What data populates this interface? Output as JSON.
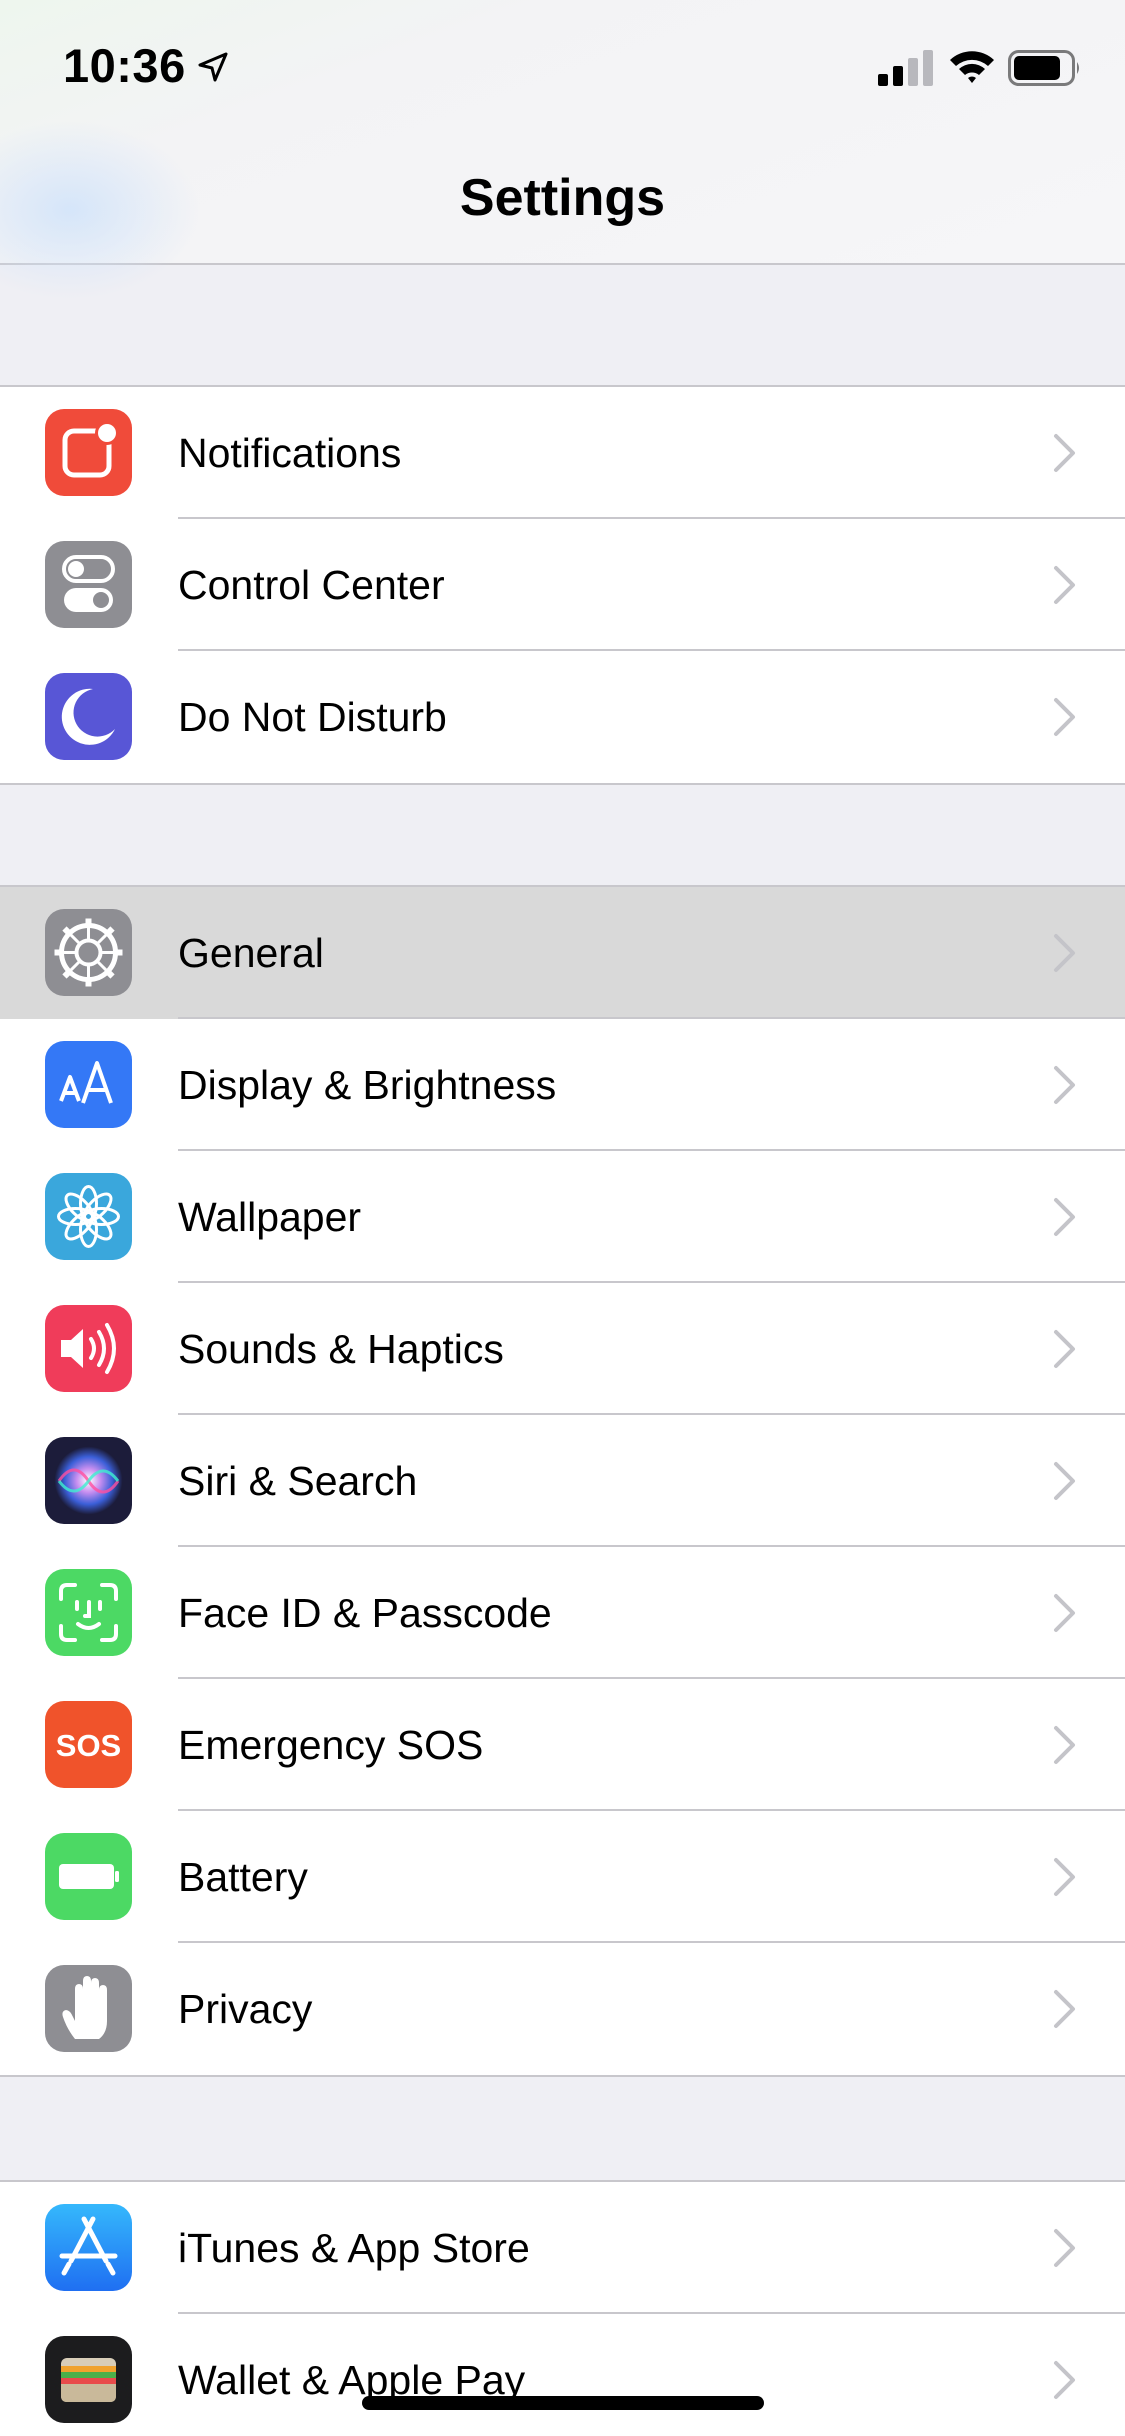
{
  "status_bar": {
    "time": "10:36"
  },
  "nav": {
    "title": "Settings"
  },
  "groups": [
    {
      "items": [
        {
          "label": "Notifications",
          "icon": "notifications-icon",
          "color": "#f04b3a"
        },
        {
          "label": "Control Center",
          "icon": "control-center-icon",
          "color": "#8e8e93"
        },
        {
          "label": "Do Not Disturb",
          "icon": "moon-icon",
          "color": "#5856d6"
        }
      ]
    },
    {
      "items": [
        {
          "label": "General",
          "icon": "gear-icon",
          "color": "#8e8e93",
          "highlighted": true
        },
        {
          "label": "Display & Brightness",
          "icon": "display-brightness-icon",
          "color": "#3478f6"
        },
        {
          "label": "Wallpaper",
          "icon": "wallpaper-flower-icon",
          "color": "#3aa7dc"
        },
        {
          "label": "Sounds & Haptics",
          "icon": "speaker-icon",
          "color": "#f03c5a"
        },
        {
          "label": "Siri & Search",
          "icon": "siri-icon",
          "color": "#1c1c3a"
        },
        {
          "label": "Face ID & Passcode",
          "icon": "face-id-icon",
          "color": "#4cd964"
        },
        {
          "label": "Emergency SOS",
          "icon": "sos-icon",
          "color": "#f0532b",
          "icon_text": "SOS"
        },
        {
          "label": "Battery",
          "icon": "battery-setting-icon",
          "color": "#4cd964"
        },
        {
          "label": "Privacy",
          "icon": "hand-icon",
          "color": "#8e8e93"
        }
      ]
    },
    {
      "items": [
        {
          "label": "iTunes & App Store",
          "icon": "app-store-icon",
          "color": "#2d8ef5"
        },
        {
          "label": "Wallet & Apple Pay",
          "icon": "wallet-icon",
          "color": "#1c1c1e"
        }
      ]
    }
  ]
}
